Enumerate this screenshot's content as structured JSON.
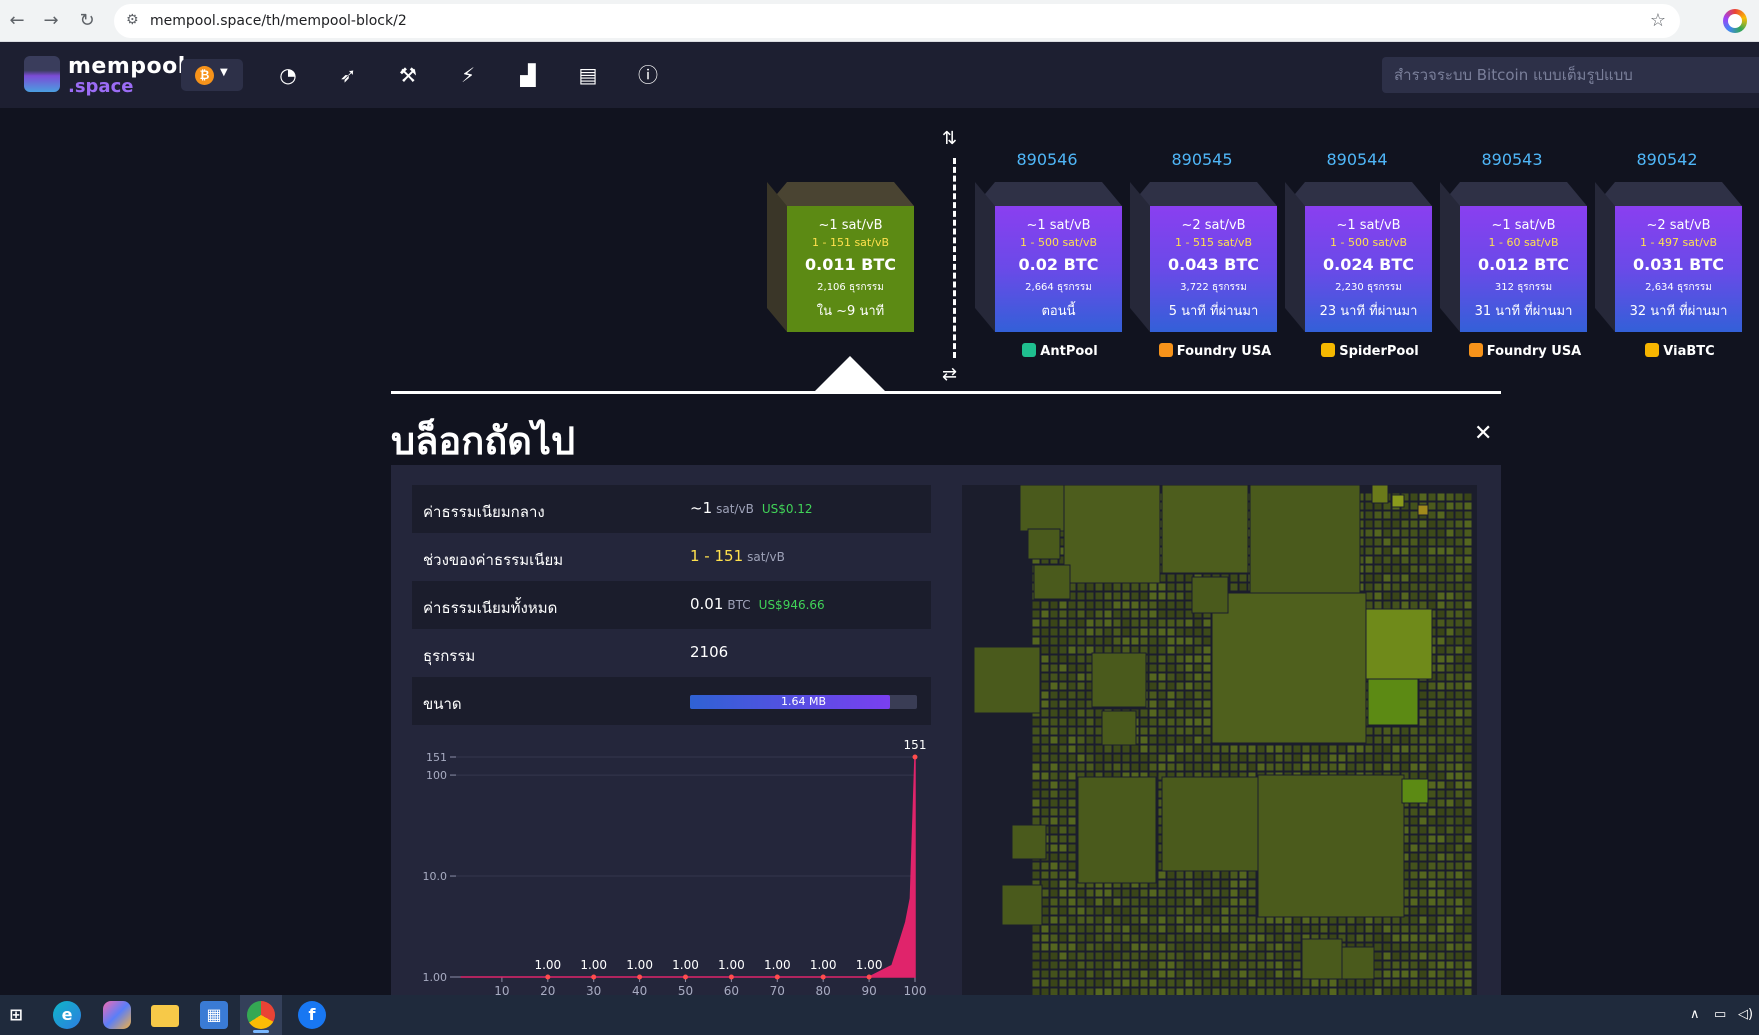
{
  "browser": {
    "url": "mempool.space/th/mempool-block/2"
  },
  "header": {
    "logo_line1": "mempool",
    "logo_line2": ".space",
    "network_icon": "bitcoin-icon",
    "search_placeholder": "สำรวจระบบ Bitcoin แบบเต็มรูปแบบ",
    "nav_icons": [
      "dashboard-icon",
      "rocket-icon",
      "hammer-icon",
      "lightning-icon",
      "chart-icon",
      "book-icon",
      "info-icon"
    ]
  },
  "pending_block": {
    "fee": "~1 sat/vB",
    "range": "1 - 151 sat/vB",
    "total": "0.011 BTC",
    "txs": "2,106 ธุรกรรม",
    "time": "ใน ~9 นาที"
  },
  "mined_blocks": [
    {
      "height": "890546",
      "fee": "~1 sat/vB",
      "range": "1 - 500 sat/vB",
      "total": "0.02 BTC",
      "txs": "2,664 ธุรกรรม",
      "time": "ตอนนี้",
      "pool": "AntPool",
      "pool_color": "#1fbf8f"
    },
    {
      "height": "890545",
      "fee": "~2 sat/vB",
      "range": "1 - 515 sat/vB",
      "total": "0.043 BTC",
      "txs": "3,722 ธุรกรรม",
      "time": "5 นาที ที่ผ่านมา",
      "pool": "Foundry USA",
      "pool_color": "#f7931a"
    },
    {
      "height": "890544",
      "fee": "~1 sat/vB",
      "range": "1 - 500 sat/vB",
      "total": "0.024 BTC",
      "txs": "2,230 ธุรกรรม",
      "time": "23 นาที ที่ผ่านมา",
      "pool": "SpiderPool",
      "pool_color": "#f5b800"
    },
    {
      "height": "890543",
      "fee": "~1 sat/vB",
      "range": "1 - 60 sat/vB",
      "total": "0.012 BTC",
      "txs": "312 ธุรกรรม",
      "time": "31 นาที ที่ผ่านมา",
      "pool": "Foundry USA",
      "pool_color": "#f7931a"
    },
    {
      "height": "890542",
      "fee": "~2 sat/vB",
      "range": "1 - 497 sat/vB",
      "total": "0.031 BTC",
      "txs": "2,634 ธุรกรรม",
      "time": "32 นาที ที่ผ่านมา",
      "pool": "ViaBTC",
      "pool_color": "#f7b500"
    }
  ],
  "details": {
    "title": "บล็อกถัดไป",
    "median_fee_label": "ค่าธรรมเนียมกลาง",
    "median_fee_value": "~1",
    "median_fee_unit": "sat/vB",
    "median_fee_usd": "US$0.12",
    "fee_span_label": "ช่วงของค่าธรรมเนียม",
    "fee_span_value": "1 - 151",
    "fee_span_unit": "sat/vB",
    "total_fees_label": "ค่าธรรมเนียมทั้งหมด",
    "total_fees_value": "0.01",
    "total_fees_unit": "BTC",
    "total_fees_usd": "US$946.66",
    "tx_label": "ธุรกรรม",
    "tx_value": "2106",
    "size_label": "ขนาด",
    "size_value": "1.64 MB",
    "size_fraction": 0.88
  },
  "chart_data": {
    "type": "area",
    "x": [
      1,
      10,
      20,
      30,
      40,
      50,
      60,
      70,
      80,
      90,
      95,
      97,
      98,
      99,
      100
    ],
    "values": [
      1,
      1,
      1,
      1,
      1,
      1,
      1,
      1,
      1,
      1,
      1.3,
      2.5,
      3.5,
      6,
      151
    ],
    "point_labels": [
      {
        "x": 20,
        "label": "1.00"
      },
      {
        "x": 30,
        "label": "1.00"
      },
      {
        "x": 40,
        "label": "1.00"
      },
      {
        "x": 50,
        "label": "1.00"
      },
      {
        "x": 60,
        "label": "1.00"
      },
      {
        "x": 70,
        "label": "1.00"
      },
      {
        "x": 80,
        "label": "1.00"
      },
      {
        "x": 90,
        "label": "1.00"
      },
      {
        "x": 100,
        "label": "151"
      }
    ],
    "x_ticks": [
      "10",
      "20",
      "30",
      "40",
      "50",
      "60",
      "70",
      "80",
      "90",
      "100"
    ],
    "y_ticks": [
      "1.00",
      "10.0",
      "100",
      "151"
    ],
    "y_scale": "log",
    "color": "#e0246b"
  },
  "taskbar": {
    "apps": [
      "windows-start-icon",
      "edge-icon",
      "copilot-icon",
      "file-explorer-icon",
      "store-icon",
      "chrome-icon",
      "facebook-icon"
    ]
  }
}
